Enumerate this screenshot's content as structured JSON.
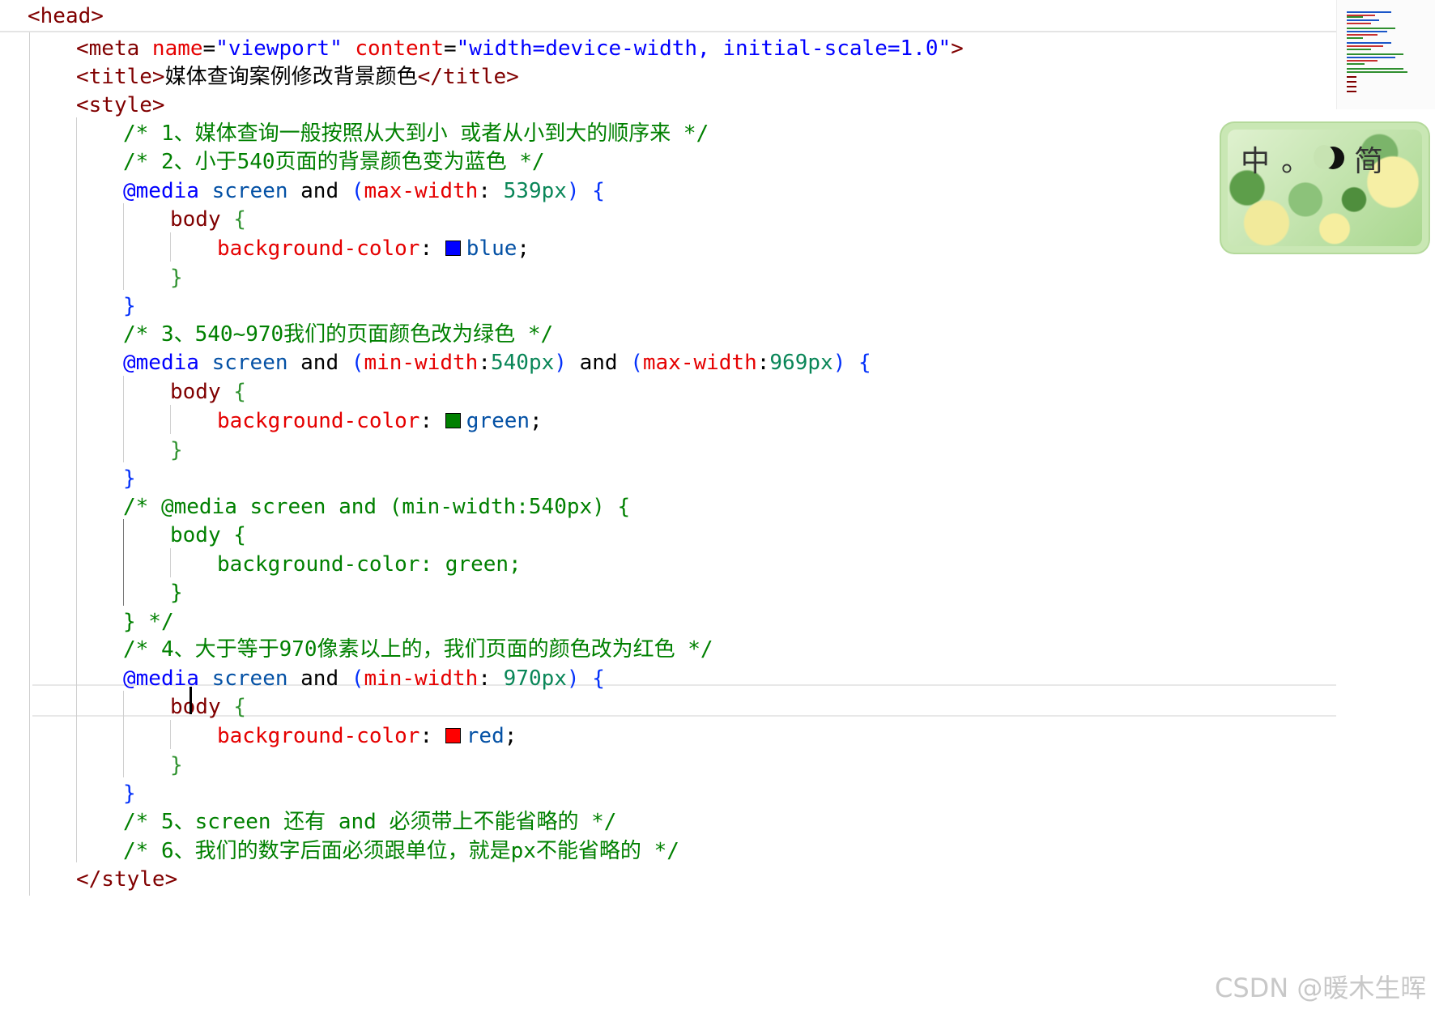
{
  "editor": {
    "lines": [
      [
        {
          "t": "<head>",
          "c": "tag"
        }
      ],
      [
        {
          "t": "<meta ",
          "c": "tag"
        },
        {
          "t": "name",
          "c": "attr"
        },
        {
          "t": "=",
          "c": "punct"
        },
        {
          "t": "\"viewport\"",
          "c": "str"
        },
        {
          "t": " ",
          "c": "punct"
        },
        {
          "t": "content",
          "c": "attr"
        },
        {
          "t": "=",
          "c": "punct"
        },
        {
          "t": "\"width=device-width, initial-scale=1.0\"",
          "c": "str"
        },
        {
          "t": ">",
          "c": "tag"
        }
      ],
      [
        {
          "t": "<title>",
          "c": "tag"
        },
        {
          "t": "媒体查询案例修改背景颜色",
          "c": "punct"
        },
        {
          "t": "</title>",
          "c": "tag"
        }
      ],
      [
        {
          "t": "<style>",
          "c": "tag"
        }
      ],
      [
        {
          "t": "/* 1、媒体查询一般按照从大到小 或者从小到大的顺序来 */",
          "c": "comment"
        }
      ],
      [
        {
          "t": "/* 2、小于540页面的背景颜色变为蓝色 */",
          "c": "comment"
        }
      ],
      [
        {
          "t": "@media",
          "c": "kw"
        },
        {
          "t": " ",
          "c": "punct"
        },
        {
          "t": "screen",
          "c": "val"
        },
        {
          "t": " and ",
          "c": "punct"
        },
        {
          "t": "(",
          "c": "paren"
        },
        {
          "t": "max-width",
          "c": "prop"
        },
        {
          "t": ": ",
          "c": "punct"
        },
        {
          "t": "539px",
          "c": "num"
        },
        {
          "t": ")",
          "c": "paren"
        },
        {
          "t": " {",
          "c": "brace"
        }
      ],
      [
        {
          "t": "body",
          "c": "tag"
        },
        {
          "t": " {",
          "c": "brace2"
        }
      ],
      [
        {
          "t": "background-color",
          "c": "prop"
        },
        {
          "t": ": ",
          "c": "punct"
        },
        {
          "sw": "#0000ff"
        },
        {
          "t": "blue",
          "c": "val"
        },
        {
          "t": ";",
          "c": "punct"
        }
      ],
      [
        {
          "t": "}",
          "c": "brace2"
        }
      ],
      [
        {
          "t": "}",
          "c": "brace"
        }
      ],
      [
        {
          "t": "/* 3、540~970我们的页面颜色改为绿色 */",
          "c": "comment"
        }
      ],
      [
        {
          "t": "@media",
          "c": "kw"
        },
        {
          "t": " ",
          "c": "punct"
        },
        {
          "t": "screen",
          "c": "val"
        },
        {
          "t": " and ",
          "c": "punct"
        },
        {
          "t": "(",
          "c": "paren"
        },
        {
          "t": "min-width",
          "c": "prop"
        },
        {
          "t": ":",
          "c": "punct"
        },
        {
          "t": "540px",
          "c": "num"
        },
        {
          "t": ")",
          "c": "paren"
        },
        {
          "t": " and ",
          "c": "punct"
        },
        {
          "t": "(",
          "c": "paren"
        },
        {
          "t": "max-width",
          "c": "prop"
        },
        {
          "t": ":",
          "c": "punct"
        },
        {
          "t": "969px",
          "c": "num"
        },
        {
          "t": ")",
          "c": "paren"
        },
        {
          "t": " {",
          "c": "brace"
        }
      ],
      [
        {
          "t": "body",
          "c": "tag"
        },
        {
          "t": " {",
          "c": "brace2"
        }
      ],
      [
        {
          "t": "background-color",
          "c": "prop"
        },
        {
          "t": ": ",
          "c": "punct"
        },
        {
          "sw": "#008000"
        },
        {
          "t": "green",
          "c": "val"
        },
        {
          "t": ";",
          "c": "punct"
        }
      ],
      [
        {
          "t": "}",
          "c": "brace2"
        }
      ],
      [
        {
          "t": "}",
          "c": "brace"
        }
      ],
      [
        {
          "t": "/* @media screen and (min-width:540px) {",
          "c": "comment"
        }
      ],
      [
        {
          "t": "body {",
          "c": "comment"
        }
      ],
      [
        {
          "t": "background-color: green;",
          "c": "comment"
        }
      ],
      [
        {
          "t": "}",
          "c": "comment"
        }
      ],
      [
        {
          "t": "} */",
          "c": "comment"
        }
      ],
      [
        {
          "t": "/* 4、大于等于970像素以上的，我们页面的颜色改为红色 */",
          "c": "comment"
        }
      ],
      [
        {
          "t": "@media",
          "c": "kw"
        },
        {
          "t": " ",
          "c": "punct"
        },
        {
          "t": "screen",
          "c": "val"
        },
        {
          "t": " and ",
          "c": "punct"
        },
        {
          "t": "(",
          "c": "paren"
        },
        {
          "t": "min-width",
          "c": "prop"
        },
        {
          "t": ": ",
          "c": "punct"
        },
        {
          "t": "970px",
          "c": "num"
        },
        {
          "t": ")",
          "c": "paren"
        },
        {
          "t": " {",
          "c": "brace"
        }
      ],
      [
        {
          "t": "body",
          "c": "tag"
        },
        {
          "t": " {",
          "c": "brace2"
        }
      ],
      [
        {
          "t": "background-color",
          "c": "prop"
        },
        {
          "t": ": ",
          "c": "punct"
        },
        {
          "sw": "#ff0000"
        },
        {
          "t": "red",
          "c": "val"
        },
        {
          "t": ";",
          "c": "punct"
        }
      ],
      [
        {
          "t": "}",
          "c": "brace2"
        }
      ],
      [
        {
          "t": "}",
          "c": "brace"
        }
      ],
      [
        {
          "t": "/* 5、screen 还有 and 必须带上不能省略的 */",
          "c": "comment"
        }
      ],
      [
        {
          "t": "/* 6、我们的数字后面必须跟单位，就是px不能省略的 */",
          "c": "comment"
        }
      ],
      [
        {
          "t": "</style>",
          "c": "tag"
        }
      ]
    ]
  },
  "ime": {
    "mode_chinese": "中",
    "punct": "。",
    "charset": "简"
  },
  "watermark": "CSDN @暖木生晖",
  "colors": {
    "comment": "#008000",
    "tag": "#800000",
    "property": "#e50000",
    "value": "#0451a5",
    "number": "#098658",
    "keyword": "#0000ff"
  }
}
